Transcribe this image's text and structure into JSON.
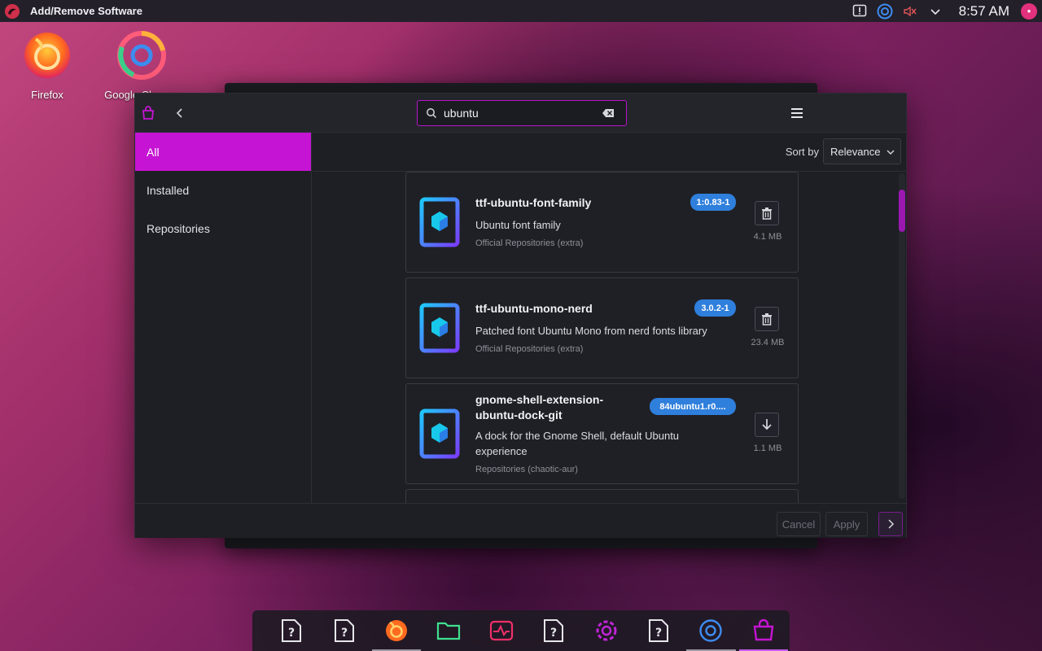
{
  "top_panel": {
    "app_title": "Add/Remove Software",
    "clock": "8:57 AM",
    "tray_icons": [
      "update-alert-icon",
      "browser-sync-icon",
      "volume-muted-icon",
      "chevron-down-icon"
    ]
  },
  "desktop": {
    "icons": [
      {
        "label": "Firefox",
        "icon": "firefox-icon"
      },
      {
        "label": "Google Chrome",
        "icon": "chrome-icon"
      }
    ]
  },
  "window": {
    "search": {
      "value": "ubuntu",
      "placeholder": ""
    },
    "sidebar": [
      {
        "label": "All",
        "active": true
      },
      {
        "label": "Installed",
        "active": false
      },
      {
        "label": "Repositories",
        "active": false
      }
    ],
    "sort": {
      "label": "Sort by",
      "selected": "Relevance"
    },
    "packages": [
      {
        "name": "ttf-ubuntu-font-family",
        "version": "1:0.83-1",
        "description": "Ubuntu font family",
        "repo": "Official Repositories (extra)",
        "size": "4.1 MB",
        "action": "remove"
      },
      {
        "name": "ttf-ubuntu-mono-nerd",
        "version": "3.0.2-1",
        "description": "Patched font Ubuntu Mono from nerd fonts library",
        "repo": "Official Repositories (extra)",
        "size": "23.4 MB",
        "action": "remove"
      },
      {
        "name": "gnome-shell-extension-ubuntu-dock-git",
        "version": "84ubuntu1.r0....",
        "description": "A dock for the Gnome Shell, default Ubuntu experience",
        "repo": "Repositories (chaotic-aur)",
        "size": "1.1 MB",
        "action": "install"
      }
    ],
    "footer": {
      "cancel": "Cancel",
      "apply": "Apply"
    }
  },
  "dock": {
    "items": [
      "unknown-app-icon",
      "unknown-app-icon",
      "firefox-icon",
      "files-icon",
      "system-monitor-icon",
      "unknown-app-icon",
      "settings-icon",
      "unknown-app-icon",
      "browser-icon",
      "software-store-icon"
    ]
  },
  "colors": {
    "accent": "#c514d3",
    "badge": "#2f7fdc",
    "package_icon_gradient": [
      "#1ec8ff",
      "#7a3cff"
    ]
  }
}
